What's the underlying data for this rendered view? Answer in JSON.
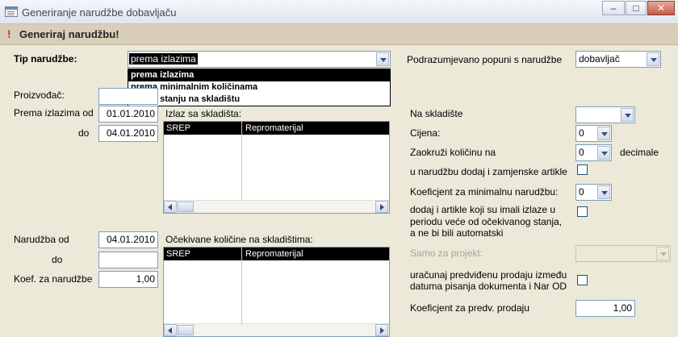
{
  "window": {
    "title": "Generiranje narudžbe dobavljaču"
  },
  "header": {
    "title": "Generiraj narudžbu!"
  },
  "left": {
    "tip_label": "Tip narudžbe:",
    "tip_value": "prema izlazima",
    "tip_options": [
      "prema izlazima",
      "prema minimalnim količinama",
      "prema stanju na skladištu"
    ],
    "proizvodac_label": "Proizvođač:",
    "proizvodac_value": "",
    "prema_izlazima_od_label": "Prema izlazima od",
    "prema_izlazima_od_value": "01.01.2010",
    "do_label": "do",
    "do_value": "04.01.2010",
    "narudzba_od_label": "Narudžba od",
    "narudzba_od_value": "04.01.2010",
    "narudzba_do_label": "do",
    "narudzba_do_value": "",
    "koef_label": "Koef. za narudžbe",
    "koef_value": "1,00"
  },
  "izlaz": {
    "label": "Izlaz sa skladišta:",
    "columns": [
      "SREP",
      "Repromaterijal"
    ]
  },
  "ocekivane": {
    "label": "Očekivane količine na skladištima:",
    "columns": [
      "SREP",
      "Repromaterijal"
    ]
  },
  "right": {
    "podrazumijevano_label": "Podrazumjevano popuni s narudžbe",
    "podrazumijevano_value": "dobavljač",
    "na_skladiste_label": "Na skladište",
    "na_skladiste_value": "",
    "cijena_label": "Cijena:",
    "cijena_value": "0",
    "zaokruzi_label": "Zaokruži količinu na",
    "zaokruzi_value": "0",
    "decimale_label": "decimale",
    "zamjenske_label": "u narudžbu dodaj i zamjenske artikle",
    "koef_min_label": "Koeficjent za minimalnu narudžbu:",
    "koef_min_value": "0",
    "dodaj_label": "dodaj i artikle koji su imali izlaze u periodu veće od očekivanog stanja, a ne bi bili automatski",
    "samo_projekt_label": "Samo za projekt:",
    "samo_projekt_value": "",
    "uracunaj_label": "uračunaj predviđenu prodaju između datuma pisanja dokumenta i Nar OD",
    "koef_predv_label": "Koeficjent za predv. prodaju",
    "koef_predv_value": "1,00"
  }
}
